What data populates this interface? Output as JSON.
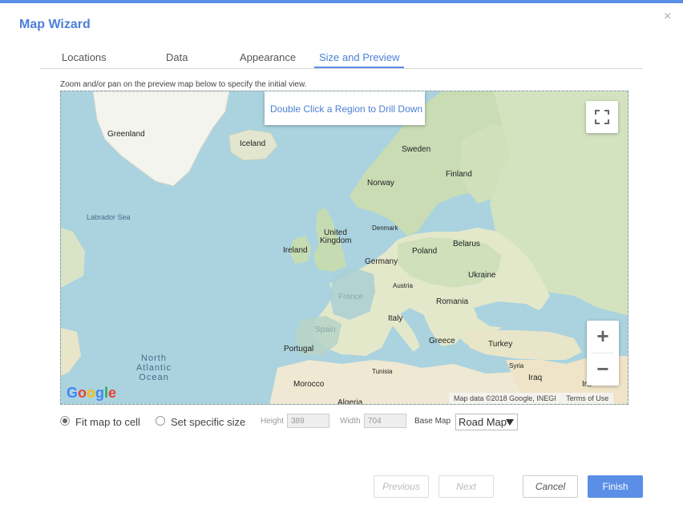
{
  "dialog": {
    "title": "Map Wizard",
    "close_icon": "×"
  },
  "tabs": [
    {
      "label": "Locations"
    },
    {
      "label": "Data"
    },
    {
      "label": "Appearance"
    },
    {
      "label": "Size and Preview"
    }
  ],
  "active_tab": "Size and Preview",
  "hint": "Zoom and/or pan on the preview map below to specify the initial view.",
  "map": {
    "tooltip": "Double Click a Region to Drill Down",
    "labels": {
      "greenland": "Greenland",
      "iceland": "Iceland",
      "sweden": "Sweden",
      "finland": "Finland",
      "norway": "Norway",
      "labrador_sea": "Labrador Sea",
      "denmark": "Denmark",
      "united_kingdom_1": "United",
      "united_kingdom_2": "Kingdom",
      "ireland": "Ireland",
      "belarus": "Belarus",
      "germany": "Germany",
      "poland": "Poland",
      "ukraine": "Ukraine",
      "austria": "Austria",
      "france": "France",
      "romania": "Romania",
      "italy": "Italy",
      "spain": "Spain",
      "north_atlantic_1": "North",
      "north_atlantic_2": "Atlantic",
      "north_atlantic_3": "Ocean",
      "portugal": "Portugal",
      "greece": "Greece",
      "turkey": "Turkey",
      "tunisia": "Tunisia",
      "syria": "Syria",
      "morocco": "Morocco",
      "iraq": "Iraq",
      "algeria": "Algeria",
      "iran_partial": "Ira"
    },
    "google_logo": "Google",
    "attribution_data": "Map data ©2018 Google, INEGI",
    "attribution_terms": "Terms of Use",
    "fullscreen_icon": "fullscreen-icon",
    "zoom_in": "+",
    "zoom_out": "−"
  },
  "size_options": {
    "fit_label": "Fit map to cell",
    "specific_label": "Set specific size",
    "selected": "fit",
    "height_label": "Height",
    "height_value": "389",
    "width_label": "Width",
    "width_value": "704",
    "base_map_label": "Base Map",
    "base_map_value": "Road Map"
  },
  "buttons": {
    "previous": "Previous",
    "next": "Next",
    "cancel": "Cancel",
    "finish": "Finish"
  },
  "colors": {
    "accent": "#5b8ee6",
    "water": "#aad3df",
    "land": "#e9e5c8",
    "forest": "#c5dcb2"
  }
}
